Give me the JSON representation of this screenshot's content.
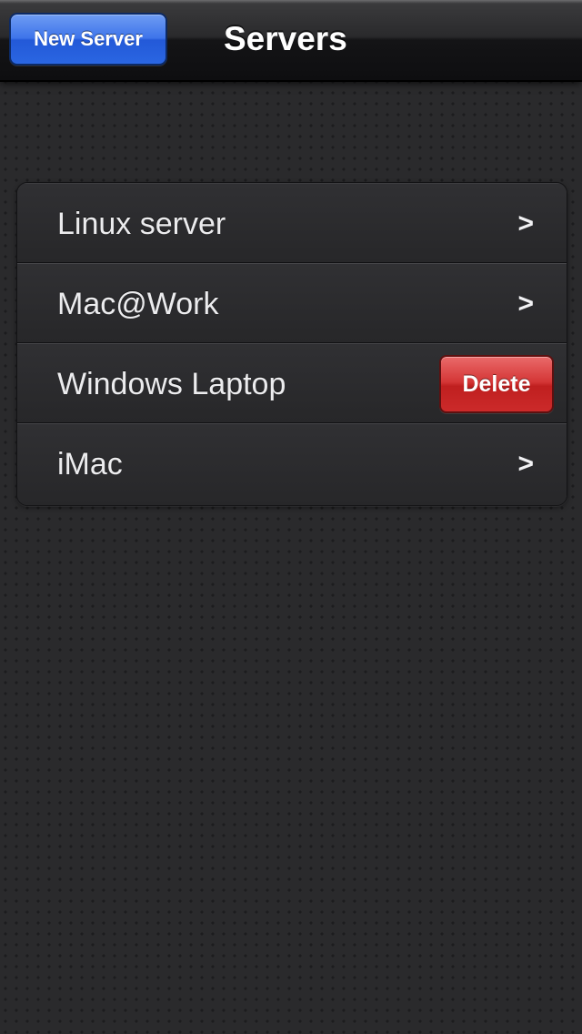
{
  "navbar": {
    "left_button_label": "New Server",
    "title": "Servers"
  },
  "servers": [
    {
      "name": "Linux server",
      "accessory": "chevron",
      "accessory_text": ">"
    },
    {
      "name": "Mac@Work",
      "accessory": "chevron",
      "accessory_text": ">"
    },
    {
      "name": "Windows Laptop",
      "accessory": "delete-button",
      "accessory_text": "Delete"
    },
    {
      "name": "iMac",
      "accessory": "chevron",
      "accessory_text": ">"
    }
  ],
  "colors": {
    "nav_button_blue": "#2a66e2",
    "delete_red": "#d43636",
    "background": "#2a2a2c",
    "row_text": "#ececee"
  },
  "icons": {
    "row_chevron": "chevron-right-icon"
  }
}
